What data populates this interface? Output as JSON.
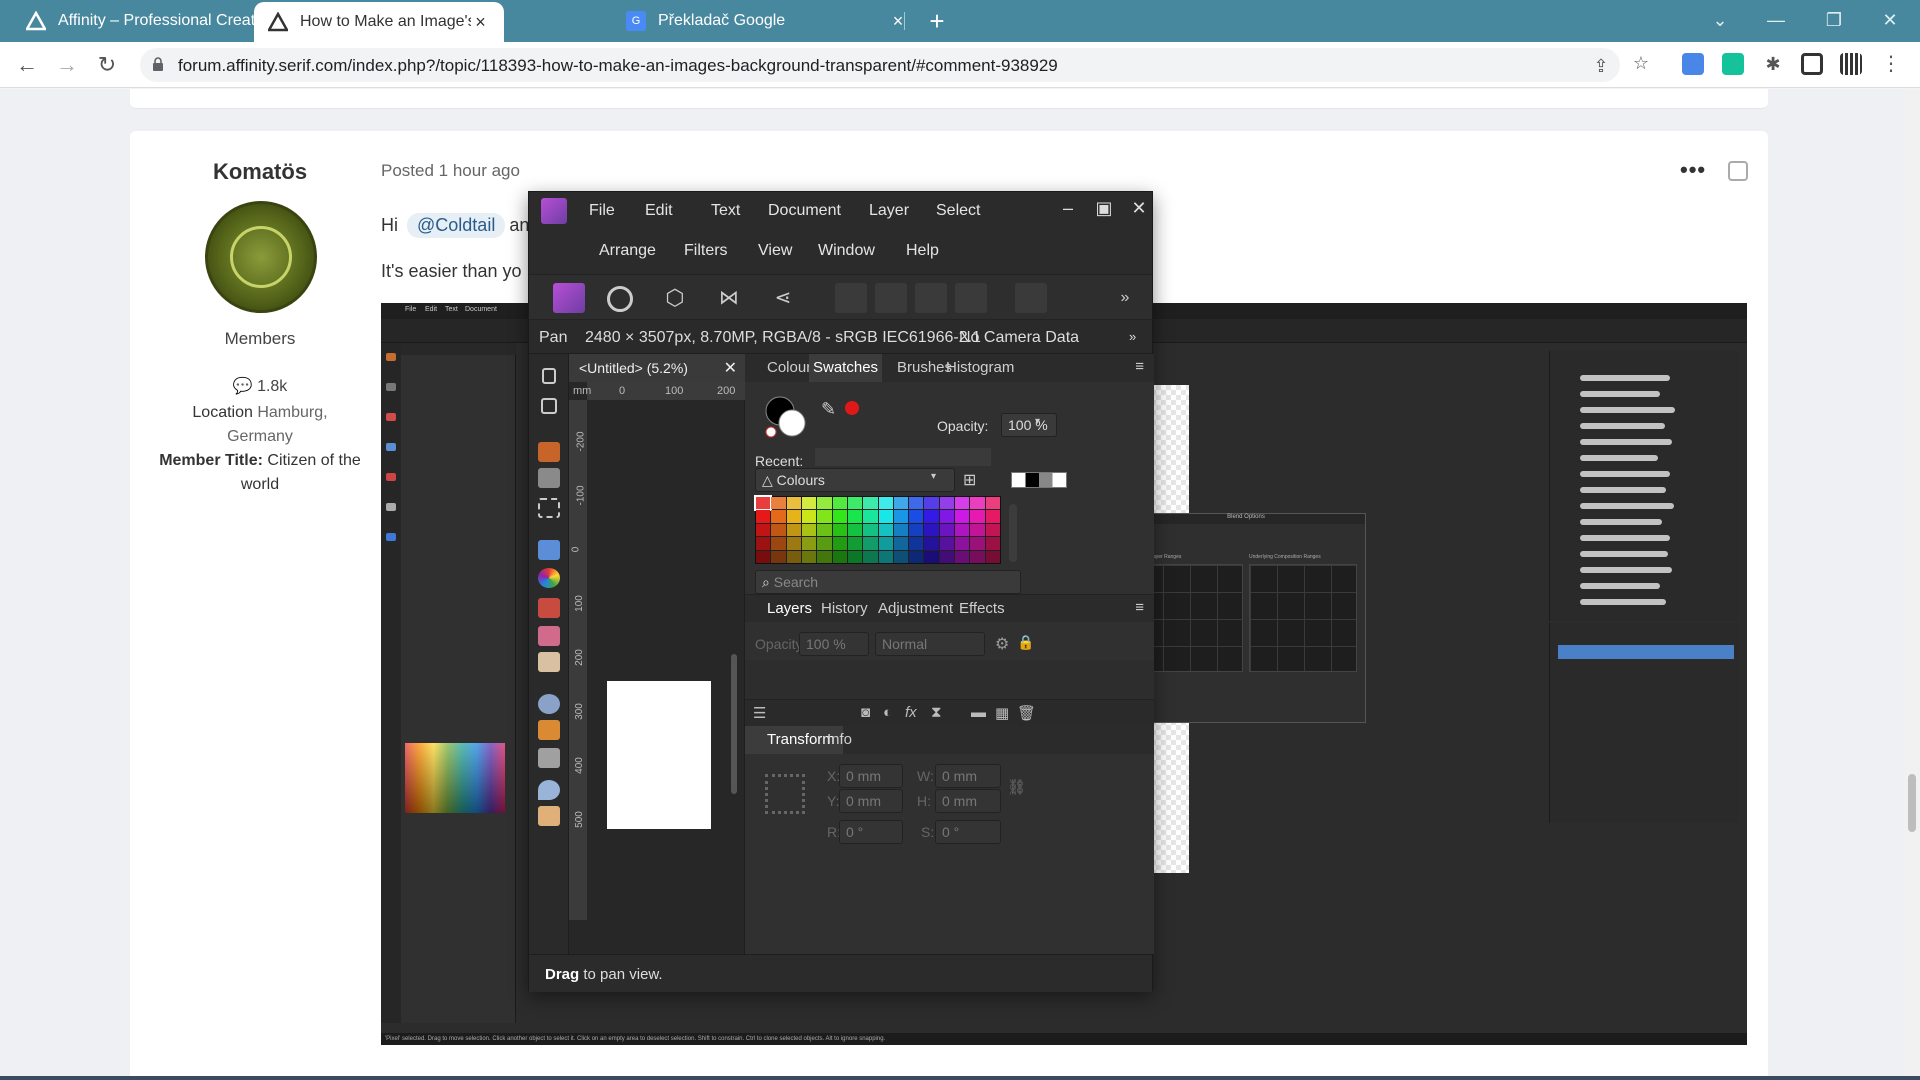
{
  "browser": {
    "tabs": [
      {
        "title": "Affinity – Professional Creative Sc",
        "active": false
      },
      {
        "title": "How to Make an Image's Backgrc",
        "active": true
      },
      {
        "title": "Překladač Google",
        "active": false
      }
    ],
    "url": "forum.affinity.serif.com/index.php?/topic/118393-how-to-make-an-images-background-transparent/#comment-938929",
    "colors": {
      "tabbar": "#48889f"
    }
  },
  "post": {
    "author": "Komatös",
    "posted": "Posted 1 hour ago",
    "role": "Members",
    "post_count": "1.8k",
    "location_label": "Location",
    "location_value": "Hamburg, Germany",
    "member_title_label": "Member Title:",
    "member_title_value": "Citizen of the world",
    "greeting": "Hi",
    "mention": "@Coldtail",
    "greeting_tail": "and",
    "line2": "It's easier than yo"
  },
  "affinity": {
    "menus_row1": [
      "File",
      "Edit",
      "Text",
      "Document",
      "Layer",
      "Select"
    ],
    "menus_row2": [
      "Arrange",
      "Filters",
      "View",
      "Window",
      "Help"
    ],
    "context_tool": "Pan",
    "doc_info": "2480 × 3507px, 8.70MP, RGBA/8 - sRGB IEC61966-2.1",
    "camera": "No Camera Data",
    "doc_tab": "<Untitled> (5.2%)",
    "ruler_unit": "mm",
    "ruler_h_ticks": [
      "0",
      "100",
      "200"
    ],
    "ruler_v_ticks": [
      "-200",
      "-100",
      "0",
      "100",
      "200",
      "300",
      "400",
      "500"
    ],
    "color_tabs": [
      "Colour",
      "Swatches",
      "Brushes",
      "Histogram"
    ],
    "color_tab_selected": "Swatches",
    "opacity_label": "Opacity:",
    "opacity_value": "100 %",
    "recent_label": "Recent:",
    "palette_name": "Colours",
    "search_placeholder": "Search",
    "layer_tabs": [
      "Layers",
      "History",
      "Adjustment",
      "Effects"
    ],
    "layer_opacity_label": "Opacity:",
    "layer_opacity": "100 %",
    "blend_mode": "Normal",
    "transform_tabs": [
      "Transform",
      "Info"
    ],
    "transform": {
      "x_label": "X:",
      "x": "0 mm",
      "y_label": "Y:",
      "y": "0 mm",
      "w_label": "W:",
      "w": "0 mm",
      "h_label": "H:",
      "h": "0 mm",
      "r_label": "R:",
      "r": "0 °",
      "s_label": "S:",
      "s": "0 °"
    },
    "status_bold": "Drag",
    "status_rest": "to pan view."
  },
  "embedded_shot": {
    "menu": [
      "File",
      "Edit",
      "Text",
      "Document"
    ],
    "blend_title": "Blend Options",
    "source_ranges": "Source Layer Ranges",
    "underlying_ranges": "Underlying Composition Ranges",
    "status": "'Pixel' selected. Drag to move selection. Click another object to select it. Click on an empty area to deselect selection. Shift to constrain. Ctrl to clone selected objects. Alt to ignore snapping."
  }
}
